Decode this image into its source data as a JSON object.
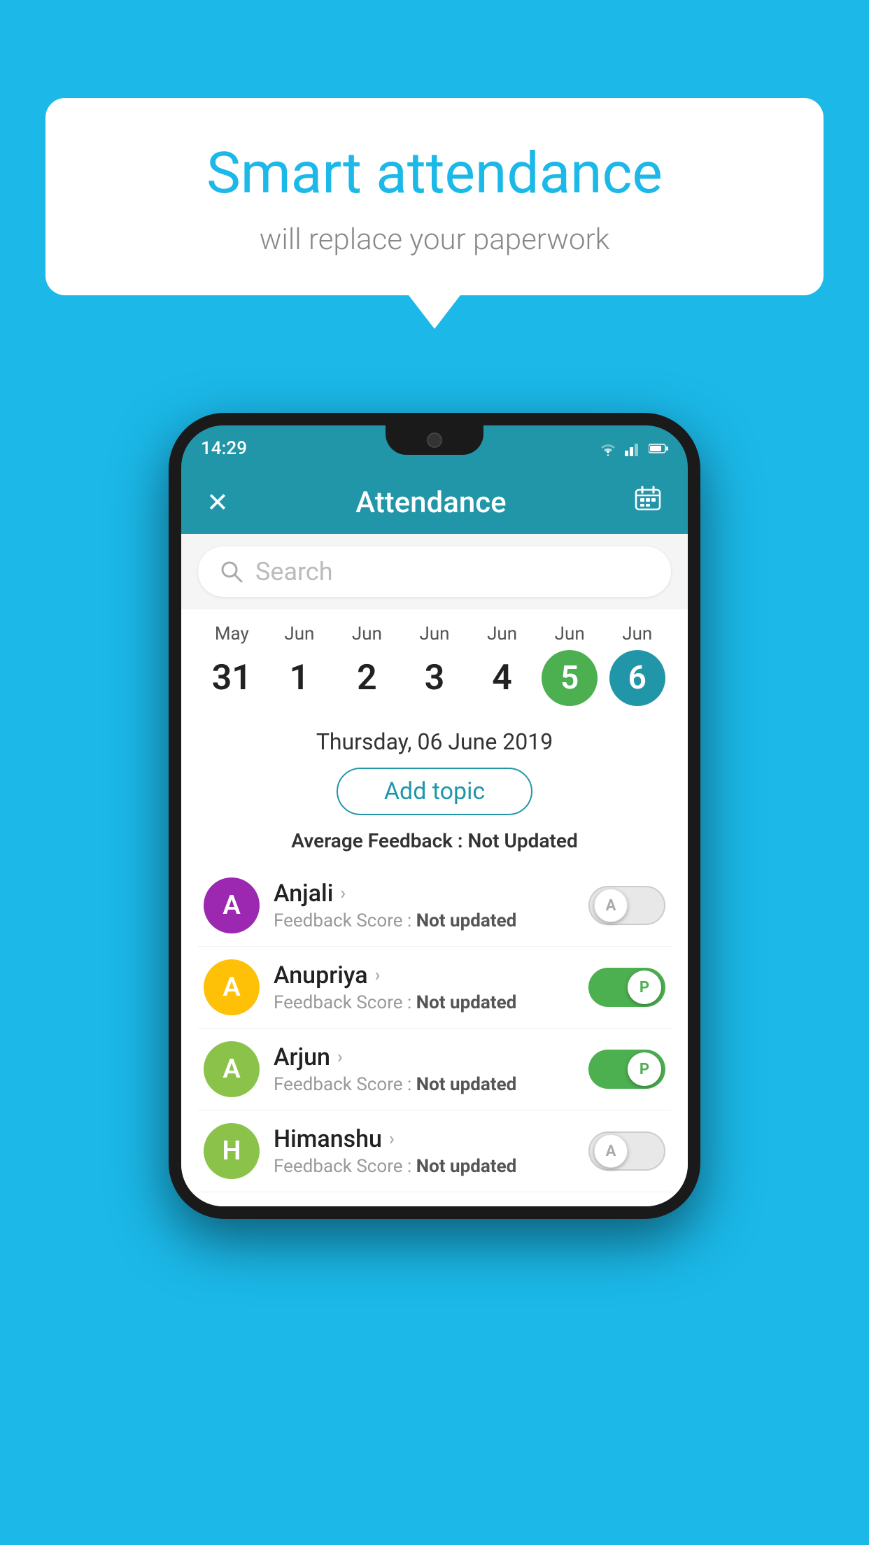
{
  "background_color": "#1bb8e8",
  "speech_bubble": {
    "title": "Smart attendance",
    "subtitle": "will replace your paperwork"
  },
  "phone": {
    "status_bar": {
      "time": "14:29",
      "icons": [
        "wifi",
        "signal",
        "battery"
      ]
    },
    "app_header": {
      "title": "Attendance",
      "close_icon": "✕",
      "calendar_icon": "📅"
    },
    "search": {
      "placeholder": "Search"
    },
    "date_columns": [
      {
        "month": "May",
        "day": "31",
        "selected": false
      },
      {
        "month": "Jun",
        "day": "1",
        "selected": false
      },
      {
        "month": "Jun",
        "day": "2",
        "selected": false
      },
      {
        "month": "Jun",
        "day": "3",
        "selected": false
      },
      {
        "month": "Jun",
        "day": "4",
        "selected": false
      },
      {
        "month": "Jun",
        "day": "5",
        "selected": "green"
      },
      {
        "month": "Jun",
        "day": "6",
        "selected": "blue"
      }
    ],
    "selected_date": "Thursday, 06 June 2019",
    "add_topic_label": "Add topic",
    "avg_feedback_label": "Average Feedback : ",
    "avg_feedback_value": "Not Updated",
    "students": [
      {
        "name": "Anjali",
        "avatar_letter": "A",
        "avatar_color": "purple",
        "feedback": "Not updated",
        "toggle_state": "off",
        "toggle_letter": "A"
      },
      {
        "name": "Anupriya",
        "avatar_letter": "A",
        "avatar_color": "yellow",
        "feedback": "Not updated",
        "toggle_state": "on",
        "toggle_letter": "P"
      },
      {
        "name": "Arjun",
        "avatar_letter": "A",
        "avatar_color": "green",
        "feedback": "Not updated",
        "toggle_state": "on",
        "toggle_letter": "P"
      },
      {
        "name": "Himanshu",
        "avatar_letter": "H",
        "avatar_color": "green2",
        "feedback": "Not updated",
        "toggle_state": "off",
        "toggle_letter": "A"
      }
    ]
  }
}
